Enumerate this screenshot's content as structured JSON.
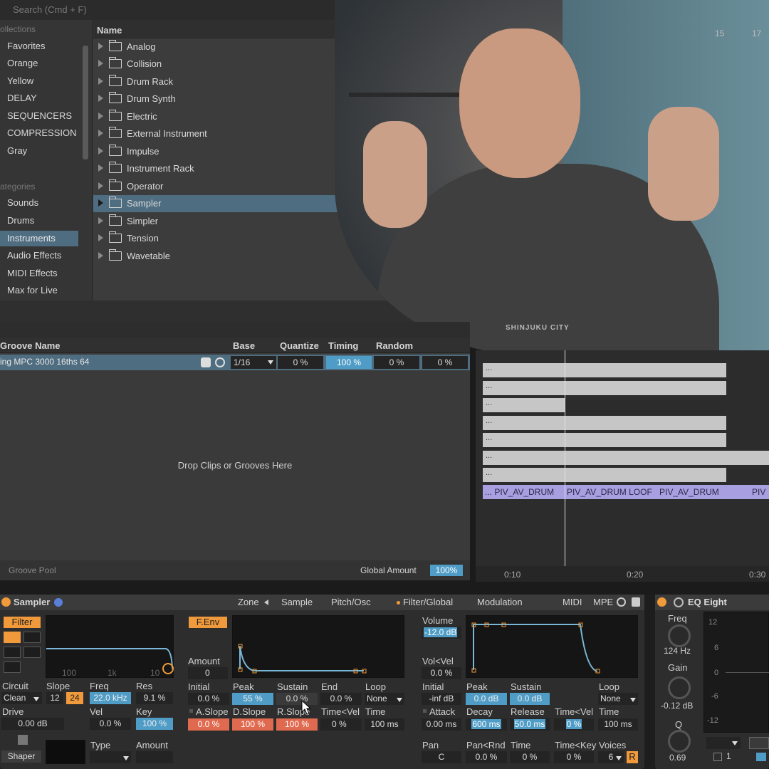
{
  "browser": {
    "search_placeholder": "Search (Cmd + F)",
    "collections_header": "ollections",
    "collections": [
      "Favorites",
      "Orange",
      "Yellow",
      "DELAY",
      "SEQUENCERS",
      "COMPRESSION",
      "Gray"
    ],
    "categories_header": "ategories",
    "categories": [
      "Sounds",
      "Drums",
      "Instruments",
      "Audio Effects",
      "MIDI Effects",
      "Max for Live"
    ],
    "selected_category": "Instruments",
    "name_header": "Name",
    "items": [
      "Analog",
      "Collision",
      "Drum Rack",
      "Drum Synth",
      "Electric",
      "External Instrument",
      "Impulse",
      "Instrument Rack",
      "Operator",
      "Sampler",
      "Simpler",
      "Tension",
      "Wavetable"
    ],
    "selected_item": "Sampler"
  },
  "overlay": {
    "shirt_text": "SHINJUKU CITY",
    "ruler_15": "15",
    "ruler_17": "17"
  },
  "groove_pool": {
    "columns": {
      "name": "Groove Name",
      "base": "Base",
      "quantize": "Quantize",
      "timing": "Timing",
      "random": "Random"
    },
    "row": {
      "name": "ing MPC 3000 16ths 64",
      "base": "1/16",
      "quantize": "0 %",
      "timing": "100 %",
      "random": "0 %",
      "velocity": "0 %"
    },
    "drop_text": "Drop Clips or Grooves Here",
    "footer_title": "Groove Pool",
    "global_amount_label": "Global Amount",
    "global_amount_value": "100%"
  },
  "arrangement": {
    "clip_label": "...",
    "purple_clips": [
      "... PIV_AV_DRUM",
      "PIV_AV_DRUM LOOF",
      "PIV_AV_DRUM",
      "PIV"
    ],
    "ruler": [
      "0:10",
      "0:20",
      "0:30"
    ]
  },
  "sampler": {
    "title": "Sampler",
    "tabs": [
      "Zone",
      "Sample",
      "Pitch/Osc",
      "Filter/Global",
      "Modulation",
      "MIDI",
      "MPE"
    ],
    "filter": {
      "btn": "Filter",
      "scale": [
        "100",
        "1k",
        "10"
      ],
      "circuit_label": "Circuit",
      "circuit": "Clean",
      "slope_label": "Slope",
      "slope_12": "12",
      "slope_24": "24",
      "freq_label": "Freq",
      "freq": "22.0 kHz",
      "res_label": "Res",
      "res": "9.1 %",
      "drive_label": "Drive",
      "drive": "0.00 dB",
      "vel_label": "Vel",
      "vel": "0.0 %",
      "key_label": "Key",
      "key": "100 %",
      "shaper_btn": "Shaper",
      "type_label": "Type",
      "amount_label": "Amount"
    },
    "fenv": {
      "btn": "F.Env",
      "amount_label": "Amount",
      "amount": "0",
      "initial_label": "Initial",
      "initial": "0.0 %",
      "peak_label": "Peak",
      "peak": "55 %",
      "sustain_label": "Sustain",
      "sustain": "0.0 %",
      "end_label": "End",
      "end": "0.0 %",
      "loop_label": "Loop",
      "loop": "None",
      "aslope_label": "A.Slope",
      "aslope": "0.0 %",
      "dslope_label": "D.Slope",
      "dslope": "100 %",
      "rslope_label": "R.Slope",
      "rslope": "100 %",
      "timevel_label": "Time<Vel",
      "timevel": "0 %",
      "time_label": "Time",
      "time": "100 ms"
    },
    "amp": {
      "volume_label": "Volume",
      "volume": "-12.0 dB",
      "volvel_label": "Vol<Vel",
      "volvel": "0.0 %",
      "initial_label": "Initial",
      "initial": "-inf dB",
      "peak_label": "Peak",
      "peak": "0.0 dB",
      "sustain_label": "Sustain",
      "sustain": "0.0 dB",
      "loop_label": "Loop",
      "loop": "None",
      "attack_label": "Attack",
      "attack": "0.00 ms",
      "decay_label": "Decay",
      "decay": "600 ms",
      "release_label": "Release",
      "release": "50.0 ms",
      "timevel_label": "Time<Vel",
      "timevel": "0 %",
      "time_label": "Time",
      "time": "100 ms",
      "pan_label": "Pan",
      "pan": "C",
      "panrnd_label": "Pan<Rnd",
      "panrnd": "0.0 %",
      "time2_label": "Time",
      "time2": "0 %",
      "timekey_label": "Time<Key",
      "timekey": "0 %",
      "voices_label": "Voices",
      "voices": "6",
      "r_btn": "R"
    }
  },
  "eq": {
    "title": "EQ Eight",
    "freq_label": "Freq",
    "freq": "124 Hz",
    "gain_label": "Gain",
    "gain": "-0.12 dB",
    "q_label": "Q",
    "q": "0.69",
    "scale": [
      "12",
      "6",
      "0",
      "-6",
      "-12"
    ],
    "band": "1"
  }
}
